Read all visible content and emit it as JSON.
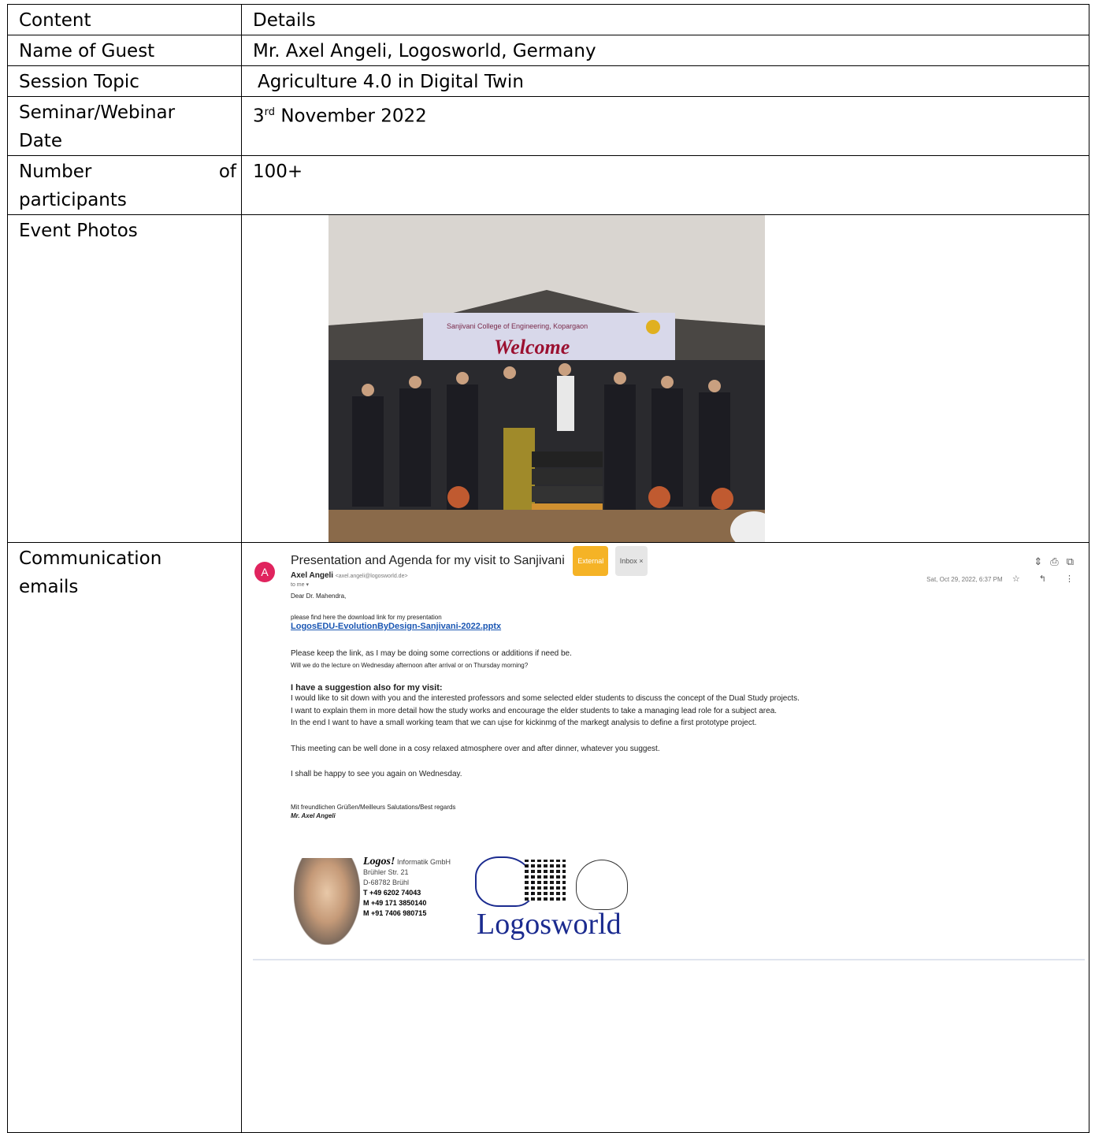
{
  "table": {
    "header": {
      "col1": "Content",
      "col2": "Details"
    },
    "guest": {
      "label": "Name of Guest",
      "value": "Mr. Axel Angeli, Logosworld, Germany"
    },
    "topic": {
      "label": "Session Topic",
      "value": "Agriculture 4.0 in Digital Twin"
    },
    "date": {
      "label_line1": "Seminar/Webinar",
      "label_line2": "Date",
      "day": "3",
      "sup": "rd",
      "rest": " November 2022"
    },
    "participants": {
      "label_word1": "Number",
      "label_word2": "of",
      "label_line2": "participants",
      "value": "100+"
    },
    "photos": {
      "label": "Event Photos"
    },
    "emails": {
      "label_line1": "Communication",
      "label_line2": "emails"
    }
  },
  "email": {
    "subject": "Presentation and Agenda for my visit to Sanjivani",
    "tag_external": "External",
    "tag_inbox": "Inbox ×",
    "avatar_letter": "A",
    "sender_name": "Axel Angeli",
    "sender_address": "<axel.angeli@logosworld.de>",
    "to_me": "to me ▾",
    "date": "Sat, Oct 29, 2022, 6:37 PM",
    "greeting": "Dear Dr. Mahendra,",
    "line1": "please find here the download link for my presentation",
    "link": "LogosEDU-EvolutionByDesign-Sanjivani-2022.pptx",
    "line2": "Please keep the link, as I may be doing some corrections or additions if need be.",
    "line3": "Will we do the lecture on Wednesday afternoon after arrival or on Thursday morning?",
    "suggest_head": "I have a suggestion also for my visit:",
    "suggest1": "I would like to sit down with you and the interested professors and some selected elder students to discuss the concept of the Dual Study projects.",
    "suggest2": "I want to explain them in more detail how the study works and encourage the elder students to take a managing lead role for a subject area.",
    "suggest3": "In the end I want to have a small working team that we can ujse for kickinmg of the markegt analysis to define a first prototype project.",
    "meeting": "This meeting can be well done in a cosy relaxed atmosphere over and after dinner, whatever you suggest.",
    "happy": "I shall be happy to see you again on Wednesday.",
    "regards": "Mit freundlichen Grüßen/Meilleurs Salutations/Best regards",
    "signname": "Mr. Axel Angeli",
    "sig_company_logo": "Logos!",
    "sig_company": " Informatik GmbH",
    "sig_street": "Brühler Str. 21",
    "sig_city": "D-68782 Brühl",
    "sig_t": "T +49 6202 74043",
    "sig_m1": "M +49 171 3850140",
    "sig_m2": "M +91 7406 980715",
    "logo_text": "Logosworld"
  },
  "photo_banner": {
    "line1": "Sanjivani College of Engineering, Kopargaon",
    "welcome": "Welcome"
  }
}
